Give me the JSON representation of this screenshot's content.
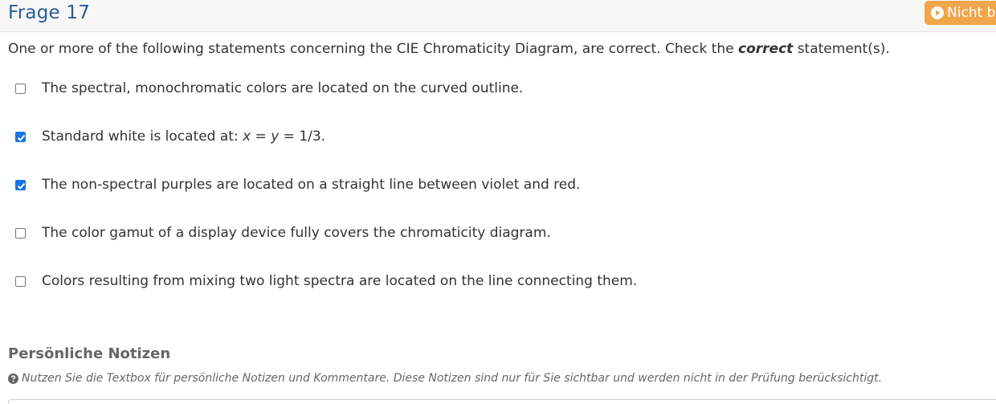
{
  "header": {
    "title": "Frage 17",
    "status_button_label": "Nicht b",
    "status_button_icon": "play-circle-icon",
    "status_button_color": "#f0a64a",
    "title_color": "#2a5d9b"
  },
  "question": {
    "text_before": "One or more of the following statements concerning the CIE Chromaticity Diagram, are correct. Check the ",
    "text_emphasis": "correct",
    "text_after": " statement(s).",
    "options": [
      {
        "label": "The spectral, monochromatic colors are located on the curved outline.",
        "checked": false
      },
      {
        "label_before": "Standard white is located at: ",
        "label_x": "x",
        "label_eq1": " = ",
        "label_y": "y",
        "label_after": " = 1/3.",
        "checked": true
      },
      {
        "label": "The non-spectral purples are located on a straight line between violet and red.",
        "checked": true
      },
      {
        "label": "The color gamut of a display device fully covers the chromaticity diagram.",
        "checked": false
      },
      {
        "label": "Colors resulting from mixing two light spectra are located on the line connecting them.",
        "checked": false
      }
    ]
  },
  "notes": {
    "title": "Persönliche Notizen",
    "hint_icon": "question-circle-icon",
    "hint": "Nutzen Sie die Textbox für persönliche Notizen und Kommentare. Diese Notizen sind nur für Sie sichtbar und werden nicht in der Prüfung berücksichtigt."
  },
  "colors": {
    "checkbox_checked": "#1a73e8"
  }
}
